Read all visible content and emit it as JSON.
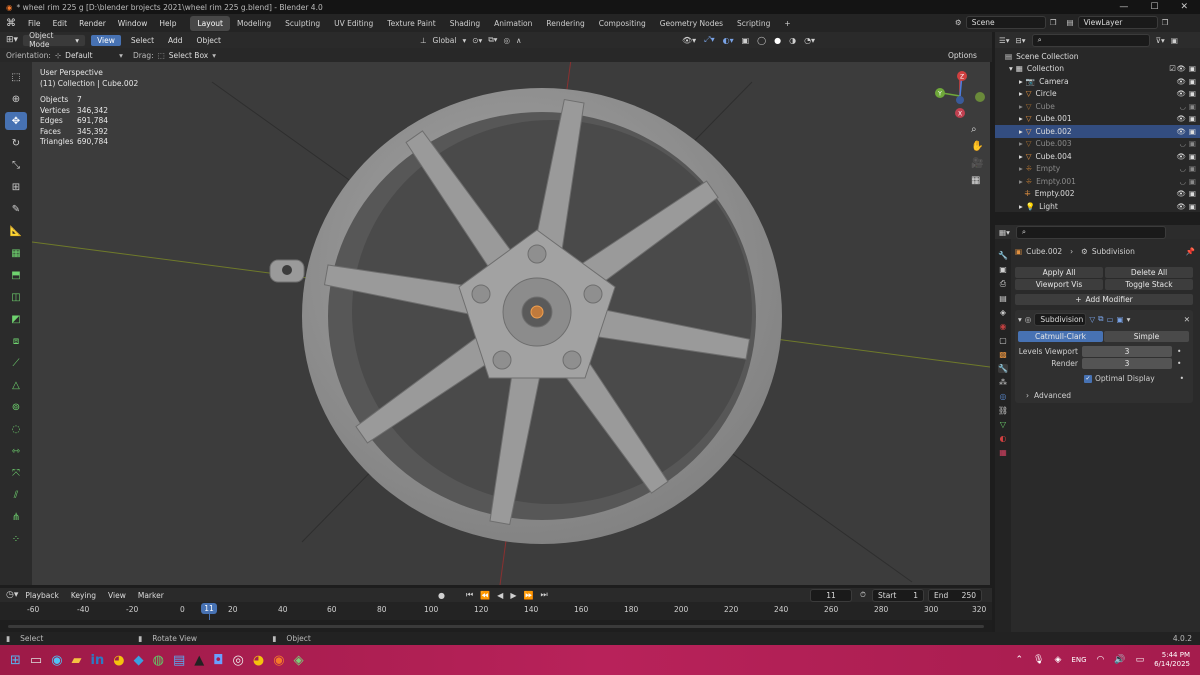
{
  "window": {
    "title": "* wheel rim 225 g [D:\\blender brojects 2021\\wheel rim 225 g.blend] - Blender 4.0",
    "minimize": "—",
    "maximize": "☐",
    "close": "✕"
  },
  "topbar": {
    "menus": [
      "File",
      "Edit",
      "Render",
      "Window",
      "Help"
    ],
    "workspaces": [
      "Layout",
      "Modeling",
      "Sculpting",
      "UV Editing",
      "Texture Paint",
      "Shading",
      "Animation",
      "Rendering",
      "Compositing",
      "Geometry Nodes",
      "Scripting"
    ],
    "add_workspace": "+",
    "scene": "Scene",
    "view_layer": "ViewLayer"
  },
  "viewport_header": {
    "mode": "Object Mode",
    "menus": [
      "View",
      "Select",
      "Add",
      "Object"
    ],
    "transform": "Global",
    "options": "Options"
  },
  "tool_settings": {
    "orientation_label": "Orientation:",
    "orientation_value": "Default",
    "drag_label": "Drag:",
    "drag_value": "Select Box"
  },
  "viewport": {
    "perspective": "User Perspective",
    "context": "(11) Collection | Cube.002",
    "stats": [
      {
        "label": "Objects",
        "value": "7"
      },
      {
        "label": "Vertices",
        "value": "346,342"
      },
      {
        "label": "Edges",
        "value": "691,784"
      },
      {
        "label": "Faces",
        "value": "345,392"
      },
      {
        "label": "Triangles",
        "value": "690,784"
      }
    ],
    "gizmo": {
      "x": "X",
      "y": "Y",
      "z": "Z"
    }
  },
  "outliner": {
    "root": "Scene Collection",
    "collection": "Collection",
    "items": [
      {
        "name": "Camera",
        "dim": false
      },
      {
        "name": "Circle",
        "dim": false
      },
      {
        "name": "Cube",
        "dim": true
      },
      {
        "name": "Cube.001",
        "dim": false
      },
      {
        "name": "Cube.002",
        "dim": false
      },
      {
        "name": "Cube.003",
        "dim": true
      },
      {
        "name": "Cube.004",
        "dim": false
      },
      {
        "name": "Empty",
        "dim": true
      },
      {
        "name": "Empty.001",
        "dim": true
      },
      {
        "name": "Empty.002",
        "dim": false
      },
      {
        "name": "Light",
        "dim": false
      }
    ]
  },
  "properties": {
    "object": "Cube.002",
    "modifier_context": "Subdivision",
    "apply_all": "Apply All",
    "delete_all": "Delete All",
    "viewport_vis": "Viewport Vis",
    "toggle_stack": "Toggle Stack",
    "add_modifier": "Add Modifier",
    "modifier_name": "Subdivision",
    "tab_catmull": "Catmull-Clark",
    "tab_simple": "Simple",
    "levels_viewport_label": "Levels Viewport",
    "levels_viewport": "3",
    "render_label": "Render",
    "render": "3",
    "optimal_display": "Optimal Display",
    "advanced": "Advanced"
  },
  "timeline": {
    "menus": [
      "Playback",
      "Keying",
      "View",
      "Marker"
    ],
    "current_frame": "11",
    "start_label": "Start",
    "start": "1",
    "end_label": "End",
    "end": "250",
    "ruler": [
      "-60",
      "-40",
      "-20",
      "0",
      "20",
      "40",
      "60",
      "80",
      "100",
      "120",
      "140",
      "160",
      "180",
      "200",
      "220",
      "240",
      "260",
      "280",
      "300",
      "320"
    ]
  },
  "statusbar": {
    "select": "Select",
    "rotate": "Rotate View",
    "object": "Object",
    "version": "4.0.2"
  },
  "taskbar": {
    "time": "5:44 PM",
    "date": "6/14/2025",
    "lang": "ENG"
  },
  "colors": {
    "accent": "#4772b3",
    "viewport_bg": "#3c3c3c",
    "taskbar": "#b8225a"
  }
}
